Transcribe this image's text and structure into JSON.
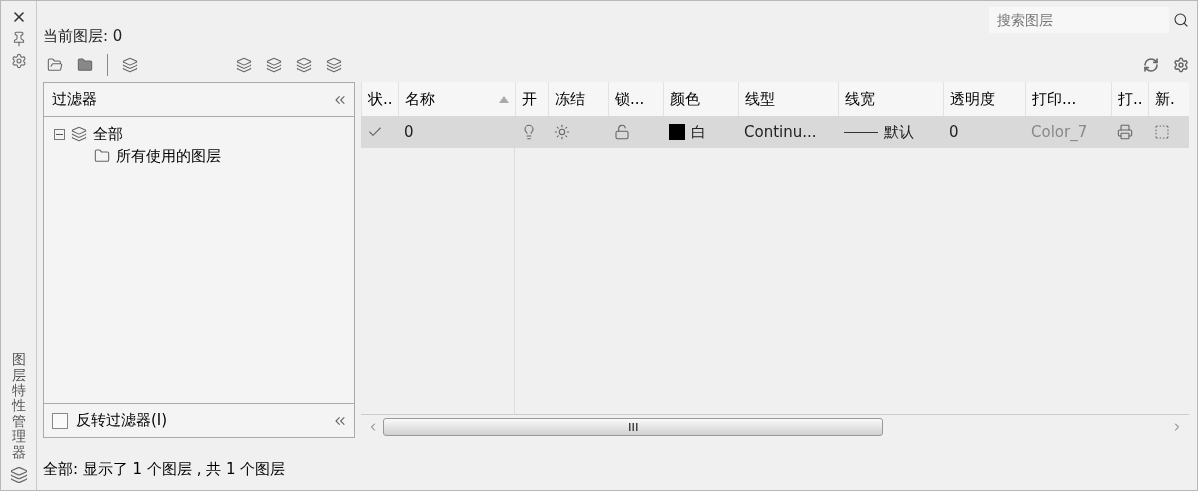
{
  "panel": {
    "title": "图层特性管理器"
  },
  "current_layer": "当前图层: 0",
  "search": {
    "placeholder": "搜索图层"
  },
  "filters": {
    "header": "过滤器",
    "tree": [
      {
        "label": "全部",
        "expanded": true,
        "children": [
          {
            "label": "所有使用的图层"
          }
        ]
      }
    ],
    "invert": {
      "label": "反转过滤器(I)",
      "checked": false
    }
  },
  "table": {
    "columns": [
      {
        "label": "状..",
        "sorted": false
      },
      {
        "label": "名称",
        "sorted": true
      },
      {
        "label": "开",
        "sorted": false
      },
      {
        "label": "冻结",
        "sorted": false
      },
      {
        "label": "锁...",
        "sorted": false
      },
      {
        "label": "颜色",
        "sorted": false
      },
      {
        "label": "线型",
        "sorted": false
      },
      {
        "label": "线宽",
        "sorted": false
      },
      {
        "label": "透明度",
        "sorted": false
      },
      {
        "label": "打印...",
        "sorted": false
      },
      {
        "label": "打..",
        "sorted": false
      },
      {
        "label": "新.",
        "sorted": false
      }
    ],
    "rows": [
      {
        "selected": true,
        "current": true,
        "name": "0",
        "on": true,
        "frozen": false,
        "locked": false,
        "color": "#000000",
        "color_name": "白",
        "linetype": "Continu...",
        "lineweight": "默认",
        "transparency": "0",
        "plot_style": "Color_7",
        "plot": true
      }
    ]
  },
  "status": "全部: 显示了 1 个图层 , 共 1 个图层"
}
